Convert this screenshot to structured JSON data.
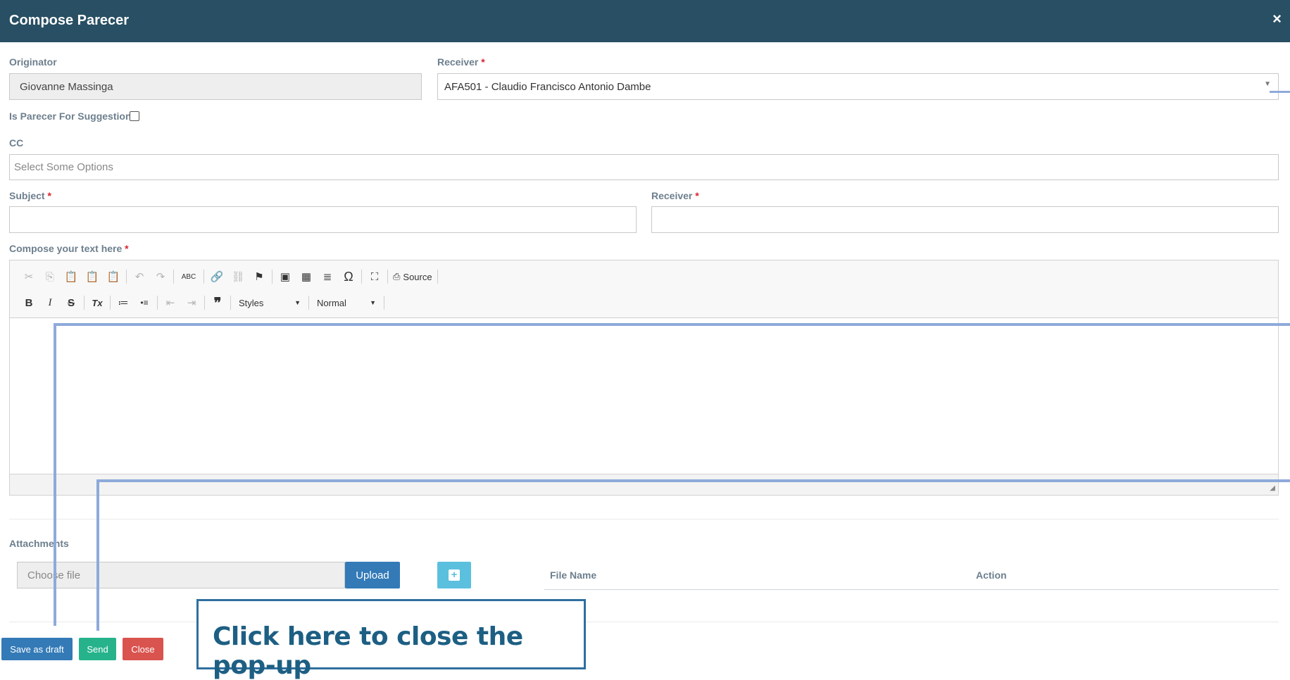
{
  "modal": {
    "title": "Compose Parecer",
    "close_glyph": "×"
  },
  "form": {
    "originator": {
      "label": "Originator",
      "value": "Giovanne Massinga"
    },
    "receiver_top": {
      "label": "Receiver",
      "required": "*",
      "value": "AFA501 - Claudio Francisco Antonio Dambe"
    },
    "suggestion": {
      "label": "Is Parecer For Suggestion",
      "checked": false
    },
    "cc": {
      "label": "CC",
      "placeholder": "Select Some Options"
    },
    "subject": {
      "label": "Subject",
      "required": "*",
      "value": ""
    },
    "receiver_bottom": {
      "label": "Receiver",
      "required": "*",
      "value": ""
    },
    "compose": {
      "label": "Compose your text here",
      "required": "*"
    }
  },
  "editor": {
    "source_label": "Source",
    "styles_label": "Styles",
    "format_label": "Normal",
    "icons": {
      "cut": "✂",
      "copy": "⎘",
      "paste": "📋",
      "paste_text": "📋",
      "paste_word": "📋",
      "undo": "↶",
      "redo": "↷",
      "spellcheck": "ABC",
      "link": "🔗",
      "unlink": "⛓",
      "anchor": "⚑",
      "image": "▣",
      "table": "▦",
      "hr": "≣",
      "special_char": "Ω",
      "maximize": "⛶",
      "source": "⎙",
      "bold": "B",
      "italic": "I",
      "strike": "S",
      "remove_format": "Tx",
      "numbered_list": "≔",
      "bulleted_list": "•≡",
      "outdent": "⇤",
      "indent": "⇥",
      "blockquote": "❞",
      "resize": "◢"
    }
  },
  "attachments": {
    "label": "Attachments",
    "file_placeholder": "Choose file",
    "upload_label": "Upload",
    "add_glyph": "+",
    "columns": [
      "File Name",
      "Action"
    ]
  },
  "footer": {
    "save_draft_label": "Save as draft",
    "send_label": "Send",
    "close_label": "Close"
  },
  "callout": {
    "text": "Click  here to close the pop-up"
  },
  "colors": {
    "header_bg": "#284f63",
    "primary": "#337ab7",
    "success": "#26b38c",
    "danger": "#d9534f",
    "info": "#5bc0de",
    "annotation_line": "#8eaadb"
  }
}
